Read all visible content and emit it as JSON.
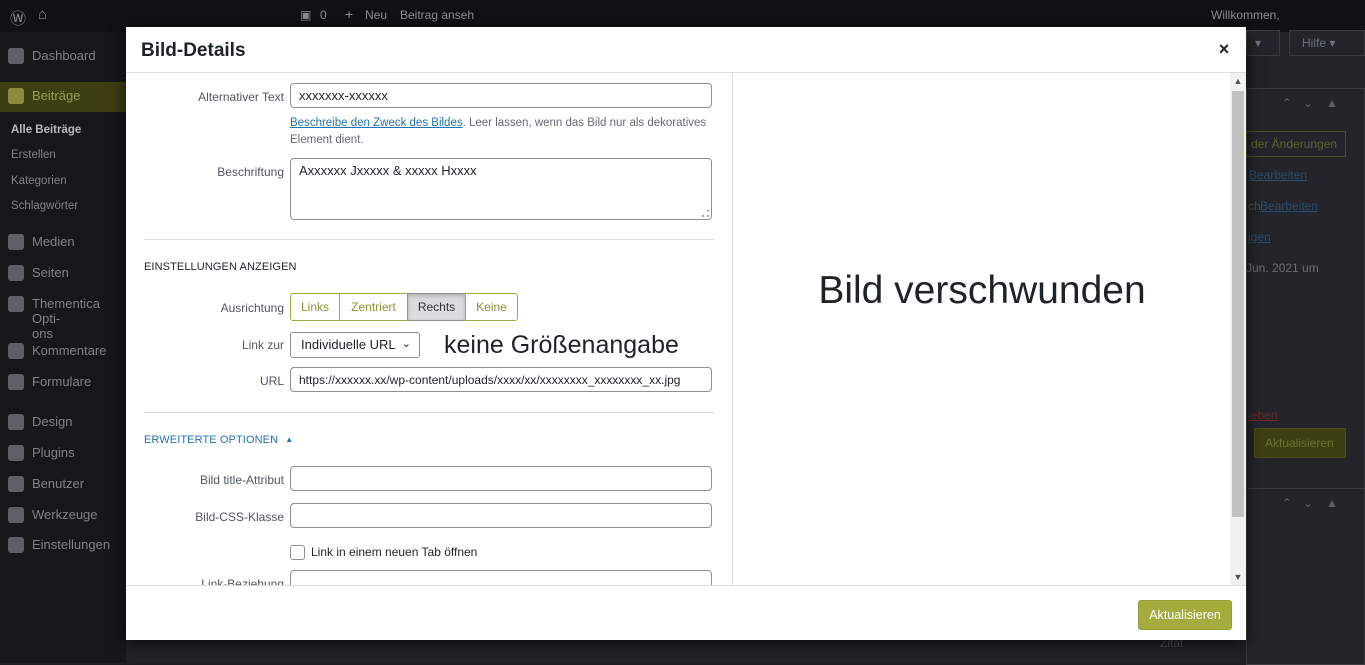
{
  "admin_bar": {
    "new_label": "Neu",
    "view_post_label": "Beitrag anseh",
    "comments_count": "0",
    "welcome": "Willkommen,"
  },
  "sidebar": {
    "items": [
      {
        "label": "Dashboard",
        "icon": "dashboard-icon"
      },
      {
        "label": "Beiträge",
        "icon": "pin-icon",
        "active": true
      },
      {
        "label": "Medien",
        "icon": "media-icon"
      },
      {
        "label": "Seiten",
        "icon": "pages-icon"
      },
      {
        "label": "Thementica Opti-\nons",
        "icon": "theme-options-icon"
      },
      {
        "label": "Kommentare",
        "icon": "comments-icon"
      },
      {
        "label": "Formulare",
        "icon": "mail-icon"
      },
      {
        "label": "Design",
        "icon": "brush-icon"
      },
      {
        "label": "Plugins",
        "icon": "plugin-icon"
      },
      {
        "label": "Benutzer",
        "icon": "user-icon"
      },
      {
        "label": "Werkzeuge",
        "icon": "wrench-icon"
      },
      {
        "label": "Einstellungen",
        "icon": "settings-icon"
      }
    ],
    "submenu": [
      "Alle Beiträge",
      "Erstellen",
      "Kategorien",
      "Schlagwörter"
    ]
  },
  "right_panel": {
    "help_label": "Hilfe ▾",
    "screen_options": "▾",
    "changes_link": "der Änderungen",
    "edit_link_1": "Bearbeiten",
    "edit_link_2": "Bearbeiten",
    "edit_prefix": "ch",
    "gen_link": "igen",
    "date_text": "Jun. 2021 um",
    "trash_link": "ieben",
    "update_label": "Aktualisieren",
    "quote_label": "Zitat"
  },
  "modal": {
    "title": "Bild-Details",
    "close_symbol": "×",
    "alt_text": {
      "label": "Alternativer Text",
      "value": "xxxxxxx-xxxxxx",
      "help_link": "Beschreibe den Zweck des Bildes",
      "help_text": ". Leer lassen, wenn das Bild nur als dekoratives Element dient."
    },
    "caption": {
      "label": "Beschriftung",
      "value": "Axxxxxx Jxxxxx & xxxxx Hxxxx"
    },
    "display_settings_title": "Einstellungen anzeigen",
    "alignment": {
      "label": "Ausrichtung",
      "options": [
        "Links",
        "Zentriert",
        "Rechts",
        "Keine"
      ],
      "selected": "Rechts"
    },
    "link_to": {
      "label": "Link zur",
      "value": "Individuelle URL"
    },
    "size_note": "keine Größenangabe",
    "url": {
      "label": "URL",
      "value": "https://xxxxxx.xx/wp-content/uploads/xxxx/xx/xxxxxxxx_xxxxxxxx_xx.jpg"
    },
    "advanced_title": "Erweiterte Optionen",
    "advanced_arrow": "▲",
    "title_attr": {
      "label": "Bild title-Attribut",
      "value": ""
    },
    "css_class": {
      "label": "Bild-CSS-Klasse",
      "value": ""
    },
    "new_tab": {
      "label": "Link in einem neuen Tab öffnen",
      "checked": false
    },
    "link_rel": {
      "label": "Link-Beziehung"
    },
    "image_placeholder": "Bild verschwunden",
    "update_button": "Aktualisieren"
  },
  "colors": {
    "accent": "#a4ac3d",
    "link": "#2271b1",
    "overlay": "#1d1f24"
  }
}
